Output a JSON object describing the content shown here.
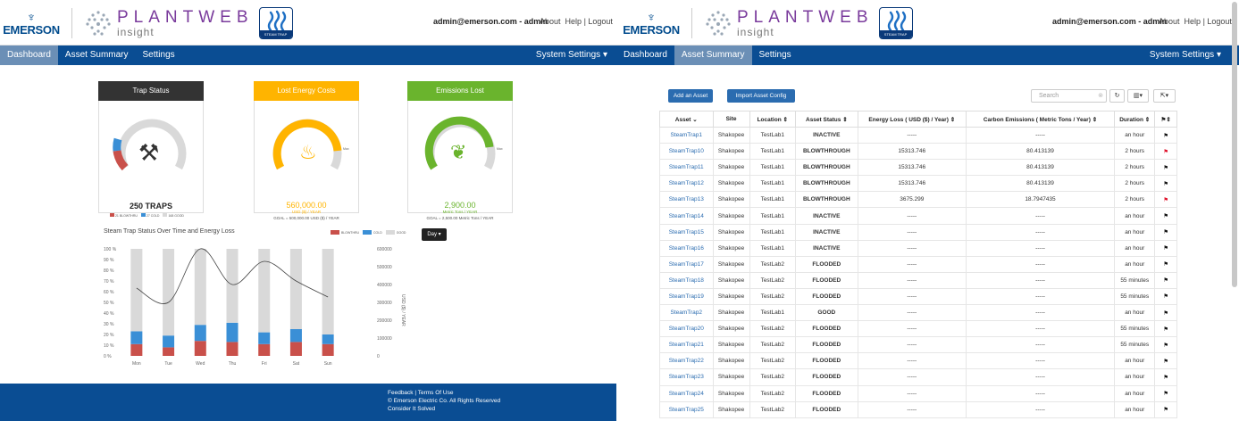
{
  "header": {
    "emerson_word": "EMERSON",
    "plantweb": "PLANTWEB",
    "insight": "insight",
    "badge_text": "STEAM TRAP",
    "user": "admin@emerson.com - admin",
    "links": [
      "About",
      "Help",
      "Logout"
    ]
  },
  "nav_left": {
    "items": [
      "Dashboard",
      "Asset Summary",
      "Settings"
    ],
    "active": 0,
    "system": "System Settings"
  },
  "nav_right": {
    "items": [
      "Dashboard",
      "Asset Summary",
      "Settings"
    ],
    "active": 1,
    "system": "System Settings"
  },
  "dashboard": {
    "cards": [
      {
        "title": "Trap Status",
        "color": "#333333",
        "value": "250 TRAPS",
        "legend": [
          "21 BLOWTHRU",
          "27 COLD",
          "168 GOOD"
        ]
      },
      {
        "title": "Lost Energy Costs",
        "color": "#ffb400",
        "value": "560,000.00",
        "unit": "USD ($) / YEAR",
        "goal": "GOAL = 500,000.00 USD ($) / YEAR",
        "max": "Max"
      },
      {
        "title": "Emissions Lost",
        "color": "#6ab42d",
        "value": "2,900.00",
        "unit": "Metric Tons / YEAR",
        "goal": "GOAL = 2,500.00 Metric Tons / YEAR",
        "max": "Max"
      }
    ],
    "chart_title": "Steam Trap Status Over Time and Energy Loss",
    "day_button": "Day"
  },
  "chart_data": {
    "type": "bar",
    "title": "Steam Trap Status Over Time and Energy Loss",
    "categories": [
      "Mon",
      "Tue",
      "Wed",
      "Thu",
      "Fri",
      "Sat",
      "Sun"
    ],
    "legend": [
      "BLOWTHRU",
      "COLD",
      "GOOD"
    ],
    "colors": {
      "blowthru": "#c9504a",
      "cold": "#3a8fd6",
      "good": "#d9d9d9"
    },
    "y_ticks_left": [
      "0 %",
      "10 %",
      "20 %",
      "30 %",
      "40 %",
      "50 %",
      "60 %",
      "70 %",
      "80 %",
      "90 %",
      "100 %"
    ],
    "y_ticks_right": [
      "0",
      "100000",
      "200000",
      "300000",
      "400000",
      "500000",
      "600000"
    ],
    "ylabel_right": "USD ($) / YEAR",
    "ylim_left": [
      0,
      100
    ],
    "ylim_right": [
      0,
      600000
    ],
    "series": [
      {
        "name": "BLOWTHRU",
        "values": [
          11,
          8,
          14,
          13,
          11,
          13,
          11
        ]
      },
      {
        "name": "COLD",
        "values": [
          12,
          11,
          15,
          18,
          11,
          12,
          9
        ]
      },
      {
        "name": "GOOD",
        "values": [
          77,
          81,
          71,
          69,
          78,
          75,
          80
        ]
      }
    ],
    "line": {
      "values": [
        380000,
        300000,
        600000,
        400000,
        530000,
        420000,
        330000
      ]
    }
  },
  "footer": {
    "lines": [
      "Feedback | Terms Of Use",
      "© Emerson Electric Co. All Rights Reserved",
      "Consider It Solved"
    ]
  },
  "assets": {
    "add_button": "Add an Asset",
    "import_button": "Import Asset Config",
    "search_placeholder": "Search",
    "columns": [
      "Asset",
      "Site",
      "Location",
      "Asset Status",
      "Energy Loss ( USD ($) / Year)",
      "Carbon Emissions ( Metric Tons / Year)",
      "Duration",
      ""
    ],
    "rows": [
      [
        "SteamTrap1",
        "Shakopee",
        "TestLab1",
        "INACTIVE",
        "-----",
        "-----",
        "an hour",
        "black"
      ],
      [
        "SteamTrap10",
        "Shakopee",
        "TestLab1",
        "BLOWTHROUGH",
        "15313.746",
        "80.413139",
        "2 hours",
        "red"
      ],
      [
        "SteamTrap11",
        "Shakopee",
        "TestLab1",
        "BLOWTHROUGH",
        "15313.746",
        "80.413139",
        "2 hours",
        "black"
      ],
      [
        "SteamTrap12",
        "Shakopee",
        "TestLab1",
        "BLOWTHROUGH",
        "15313.746",
        "80.413139",
        "2 hours",
        "black"
      ],
      [
        "SteamTrap13",
        "Shakopee",
        "TestLab1",
        "BLOWTHROUGH",
        "3675.299",
        "18.7947435",
        "2 hours",
        "red"
      ],
      [
        "SteamTrap14",
        "Shakopee",
        "TestLab1",
        "INACTIVE",
        "-----",
        "-----",
        "an hour",
        "black"
      ],
      [
        "SteamTrap15",
        "Shakopee",
        "TestLab1",
        "INACTIVE",
        "-----",
        "-----",
        "an hour",
        "black"
      ],
      [
        "SteamTrap16",
        "Shakopee",
        "TestLab1",
        "INACTIVE",
        "-----",
        "-----",
        "an hour",
        "black"
      ],
      [
        "SteamTrap17",
        "Shakopee",
        "TestLab2",
        "FLOODED",
        "-----",
        "-----",
        "an hour",
        "black"
      ],
      [
        "SteamTrap18",
        "Shakopee",
        "TestLab2",
        "FLOODED",
        "-----",
        "-----",
        "55 minutes",
        "black"
      ],
      [
        "SteamTrap19",
        "Shakopee",
        "TestLab2",
        "FLOODED",
        "-----",
        "-----",
        "55 minutes",
        "black"
      ],
      [
        "SteamTrap2",
        "Shakopee",
        "TestLab1",
        "GOOD",
        "-----",
        "-----",
        "an hour",
        "black"
      ],
      [
        "SteamTrap20",
        "Shakopee",
        "TestLab2",
        "FLOODED",
        "-----",
        "-----",
        "55 minutes",
        "black"
      ],
      [
        "SteamTrap21",
        "Shakopee",
        "TestLab2",
        "FLOODED",
        "-----",
        "-----",
        "55 minutes",
        "black"
      ],
      [
        "SteamTrap22",
        "Shakopee",
        "TestLab2",
        "FLOODED",
        "-----",
        "-----",
        "an hour",
        "black"
      ],
      [
        "SteamTrap23",
        "Shakopee",
        "TestLab2",
        "FLOODED",
        "-----",
        "-----",
        "an hour",
        "black"
      ],
      [
        "SteamTrap24",
        "Shakopee",
        "TestLab2",
        "FLOODED",
        "-----",
        "-----",
        "an hour",
        "black"
      ],
      [
        "SteamTrap25",
        "Shakopee",
        "TestLab2",
        "FLOODED",
        "-----",
        "-----",
        "an hour",
        "black"
      ]
    ]
  }
}
